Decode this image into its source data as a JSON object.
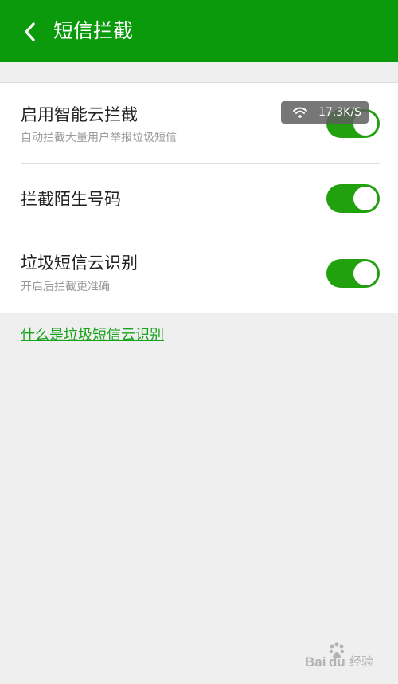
{
  "header": {
    "title": "短信拦截",
    "back_icon": "chevron-left-icon"
  },
  "settings": [
    {
      "title": "启用智能云拦截",
      "subtitle": "自动拦截大量用户举报垃圾短信",
      "enabled": true
    },
    {
      "title": "拦截陌生号码",
      "enabled": true
    },
    {
      "title": "垃圾短信云识别",
      "subtitle": "开启后拦截更准确",
      "enabled": true
    }
  ],
  "network_overlay": {
    "icon": "wifi-icon",
    "speed": "17.3K/S"
  },
  "help_link": {
    "label": "什么是垃圾短信云识别"
  },
  "watermark": {
    "text": "Baidu 经验"
  },
  "colors": {
    "header_bg": "#0b9a0b",
    "toggle_on": "#22a10f",
    "link": "#17a31b",
    "page_bg": "#efefef"
  }
}
